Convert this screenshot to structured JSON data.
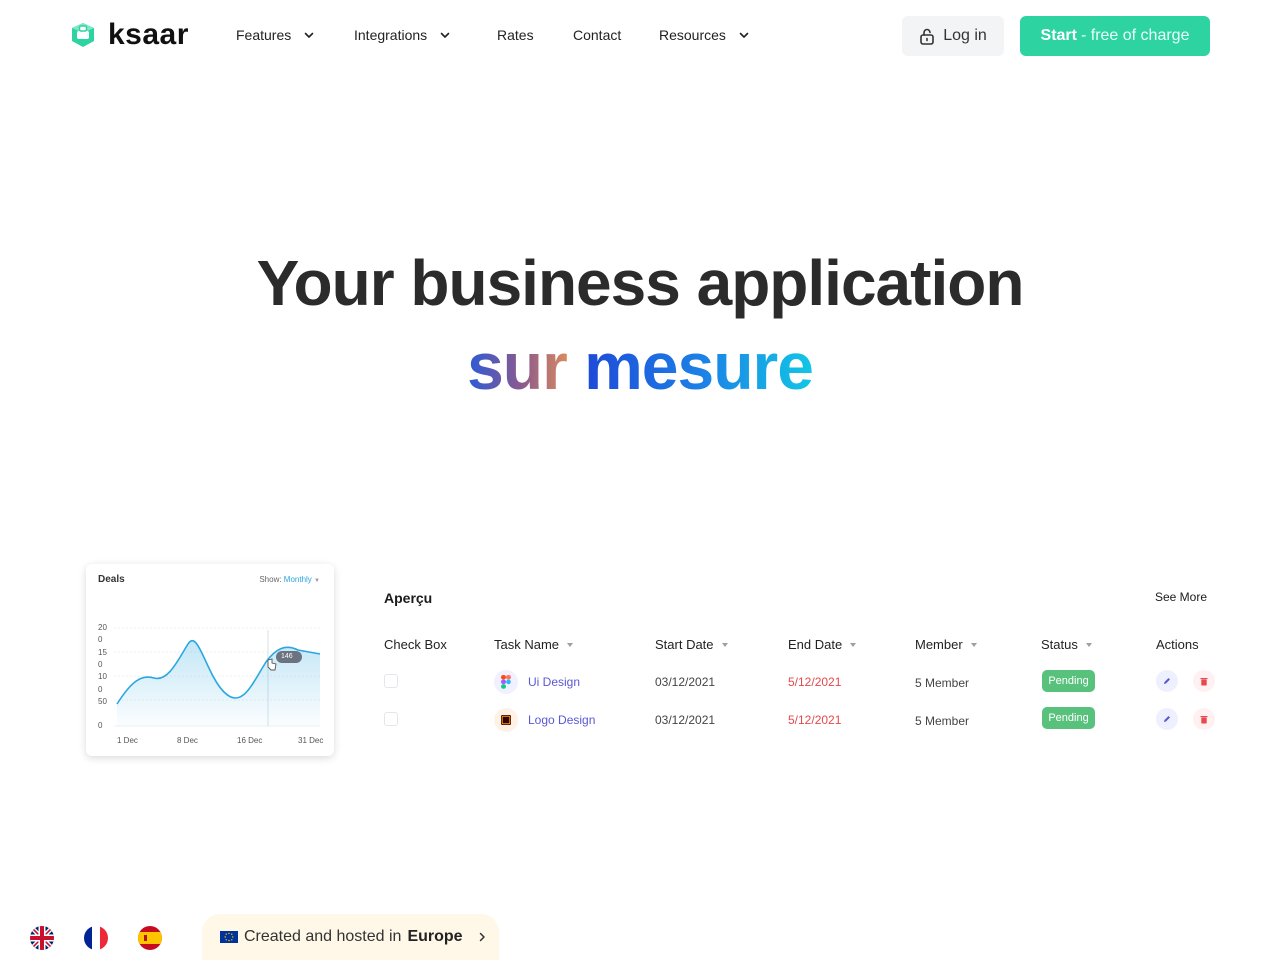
{
  "brand": {
    "name": "ksaar",
    "accent": "#2ed3a2"
  },
  "nav": {
    "items": [
      {
        "label": "Features",
        "has_dropdown": true
      },
      {
        "label": "Integrations",
        "has_dropdown": true
      },
      {
        "label": "Rates",
        "has_dropdown": false
      },
      {
        "label": "Contact",
        "has_dropdown": false
      },
      {
        "label": "Resources",
        "has_dropdown": true
      }
    ],
    "login_label": "Log in",
    "start_strong": "Start",
    "start_rest": " - free of charge"
  },
  "hero": {
    "line1": "Your business application",
    "line2_word1": "sur",
    "line2_word2": "mesure"
  },
  "deals_card": {
    "title": "Deals",
    "show_label": "Show:",
    "show_value": "Monthly",
    "tooltip_value": "146",
    "y_labels": [
      "20",
      "0",
      "15",
      "0",
      "10",
      "0",
      "50",
      "0"
    ],
    "x_labels": [
      "1 Dec",
      "8 Dec",
      "16 Dec",
      "31 Dec"
    ],
    "line_color": "#2aa7e0"
  },
  "table": {
    "title": "Aperçu",
    "see_more": "See More",
    "headers": {
      "check": "Check Box",
      "task": "Task Name",
      "start": "Start Date",
      "end": "End Date",
      "member": "Member",
      "status": "Status",
      "actions": "Actions"
    },
    "rows": [
      {
        "task": "Ui Design",
        "start": "03/12/2021",
        "end": "5/12/2021",
        "member": "5 Member",
        "status": "Pending",
        "icon": "figma-icon"
      },
      {
        "task": "Logo Design",
        "start": "03/12/2021",
        "end": "5/12/2021",
        "member": "5 Member",
        "status": "Pending",
        "icon": "illustrator-icon"
      }
    ]
  },
  "footer": {
    "languages": [
      "uk-flag-icon",
      "france-flag-icon",
      "spain-flag-icon"
    ],
    "eu_text": "Created and hosted in",
    "eu_strong": "Europe"
  }
}
